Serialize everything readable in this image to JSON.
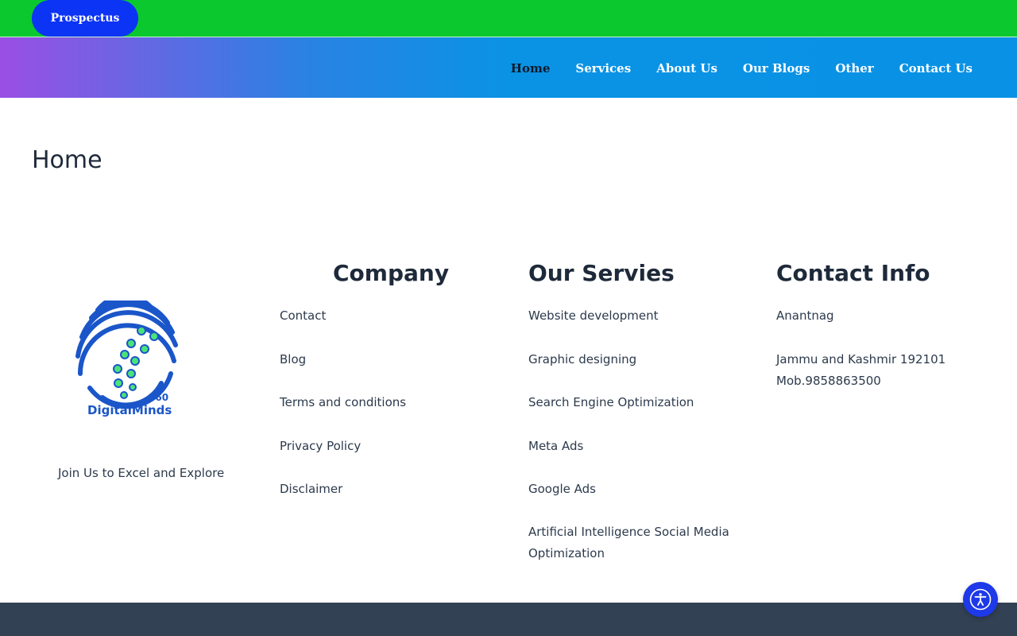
{
  "topbar": {
    "prospectus_label": "Prospectus"
  },
  "nav": {
    "items": [
      {
        "label": "Home",
        "active": true
      },
      {
        "label": "Services"
      },
      {
        "label": "About Us"
      },
      {
        "label": "Our Blogs"
      },
      {
        "label": "Other"
      },
      {
        "label": "Contact Us"
      }
    ]
  },
  "page": {
    "title": "Home"
  },
  "brand": {
    "logo_text": "DigitalMinds",
    "logo_number": "360",
    "tagline": "Join Us to Excel and Explore"
  },
  "company": {
    "heading": "Company",
    "links": [
      "Contact",
      "Blog",
      "Terms and conditions",
      "Privacy Policy",
      "Disclaimer"
    ]
  },
  "services": {
    "heading": "Our Servies",
    "links": [
      "Website development",
      "Graphic designing",
      "Search Engine Optimization",
      "Meta Ads",
      "Google Ads",
      "Artificial Intelligence Social Media",
      "Optimization"
    ]
  },
  "contact": {
    "heading": "Contact Info",
    "lines": [
      "Anantnag",
      "Jammu and Kashmir 192101",
      "Mob.9858863500"
    ]
  },
  "icons": {
    "accessibility": "accessibility-icon"
  },
  "colors": {
    "topbar": "#0bc82f",
    "prospectus_button": "#0c34f5",
    "nav_gradient_start": "#9a4fe3",
    "nav_gradient_end": "#0992e5",
    "footer_bar": "#334155",
    "accessibility_button": "#1d39e8"
  }
}
